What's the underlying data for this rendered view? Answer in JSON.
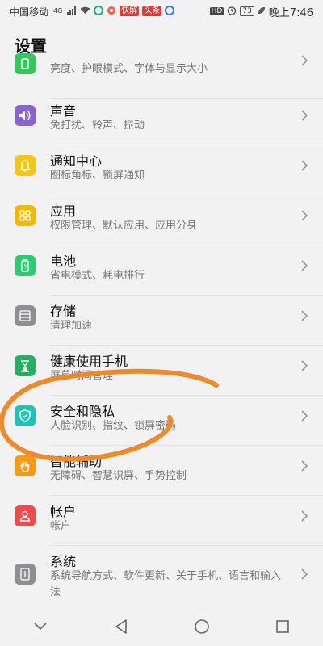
{
  "status_bar": {
    "carrier": "中国移动",
    "network": "4G",
    "badge1": "快解",
    "badge2": "头条",
    "hd": "HD",
    "battery": "73",
    "time": "晚上7:46"
  },
  "header": {
    "title": "设置"
  },
  "items": [
    {
      "title": "",
      "subtitle": "亮度、护眼模式、字体与显示大小",
      "icon": "display-icon",
      "color": "#34c759"
    },
    {
      "title": "声音",
      "subtitle": "免打扰、铃声、振动",
      "icon": "speaker-icon",
      "color": "#8a63d2"
    },
    {
      "title": "通知中心",
      "subtitle": "图标角标、锁屏通知",
      "icon": "bell-icon",
      "color": "#f5c518"
    },
    {
      "title": "应用",
      "subtitle": "权限管理、默认应用、应用分身",
      "icon": "apps-grid-icon",
      "color": "#f5b800"
    },
    {
      "title": "电池",
      "subtitle": "省电模式、耗电排行",
      "icon": "battery-icon",
      "color": "#2ecc71"
    },
    {
      "title": "存储",
      "subtitle": "清理加速",
      "icon": "storage-icon",
      "color": "#8e8e93"
    },
    {
      "title": "健康使用手机",
      "subtitle": "屏幕时间管理",
      "icon": "hourglass-icon",
      "color": "#27ae60"
    },
    {
      "title": "安全和隐私",
      "subtitle": "人脸识别、指纹、锁屏密码",
      "icon": "shield-icon",
      "color": "#1fc2b4"
    },
    {
      "title": "智能辅助",
      "subtitle": "无障碍、智慧识屏、手势控制",
      "icon": "hand-icon",
      "color": "#f39c12"
    },
    {
      "title": "帐户",
      "subtitle": "帐户",
      "icon": "person-icon",
      "color": "#ef4b4b"
    },
    {
      "title": "系统",
      "subtitle": "系统导航方式、软件更新、关于手机、语言和输入法",
      "icon": "phone-info-icon",
      "color": "#8e8e93"
    }
  ],
  "nav": {
    "collapse": "chevron-down-icon",
    "back": "back-triangle-icon",
    "home": "home-circle-icon",
    "recent": "recent-square-icon"
  },
  "annotation_color": "#ef8a2b"
}
